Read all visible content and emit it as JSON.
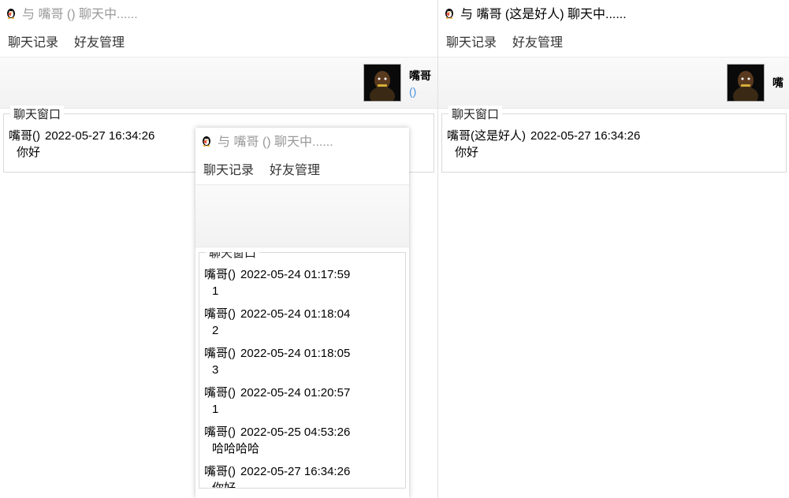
{
  "menu": {
    "history": "聊天记录",
    "friends": "好友管理"
  },
  "chat_group_label": "聊天窗口",
  "w1": {
    "title": "与 嘴哥 () 聊天中......",
    "friend_name": "嘴哥",
    "friend_sub": "()",
    "messages": [
      {
        "sender": "嘴哥()",
        "ts": "2022-05-27 16:34:26",
        "body": "你好"
      }
    ]
  },
  "w2": {
    "title": "与 嘴哥 () 聊天中......",
    "messages": [
      {
        "sender": "嘴哥()",
        "ts": "2022-05-24 01:17:59",
        "body": "1"
      },
      {
        "sender": "嘴哥()",
        "ts": "2022-05-24 01:18:04",
        "body": "2"
      },
      {
        "sender": "嘴哥()",
        "ts": "2022-05-24 01:18:05",
        "body": "3"
      },
      {
        "sender": "嘴哥()",
        "ts": "2022-05-24 01:20:57",
        "body": "1"
      },
      {
        "sender": "嘴哥()",
        "ts": "2022-05-25 04:53:26",
        "body": "哈哈哈哈"
      },
      {
        "sender": "嘴哥()",
        "ts": "2022-05-27 16:34:26",
        "body": "你好"
      }
    ]
  },
  "w3": {
    "title": "与 嘴哥 (这是好人) 聊天中......",
    "friend_name": "嘴",
    "messages": [
      {
        "sender": "嘴哥(这是好人)",
        "ts": "2022-05-27 16:34:26",
        "body": "你好"
      }
    ]
  }
}
